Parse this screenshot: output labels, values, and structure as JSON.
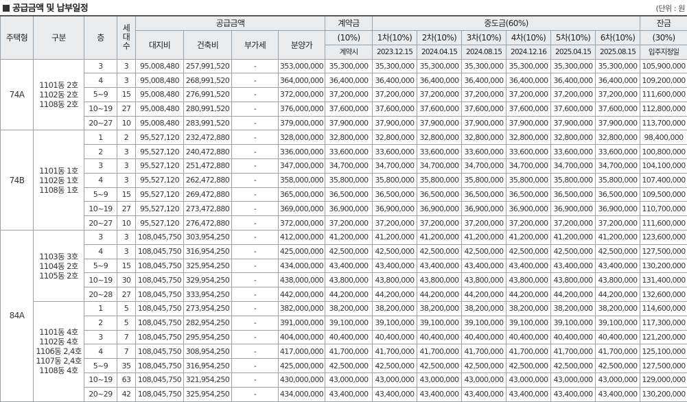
{
  "title": "공급금액 및 납부일정",
  "unit": "(단위 : 원",
  "headers": {
    "type": "주택형",
    "group": "구분",
    "floor": "층",
    "households": "세대수",
    "supply": "공급금액",
    "land": "대지비",
    "building": "건축비",
    "vat": "부가세",
    "sale": "분양가",
    "contract_top": "계약금",
    "contract_pct": "(10%)",
    "contract_when": "계약시",
    "middle": "중도금(60%)",
    "middle_rounds": [
      {
        "label": "1차(10%)",
        "date": "2023.12.15"
      },
      {
        "label": "2차(10%)",
        "date": "2024.04.15"
      },
      {
        "label": "3차(10%)",
        "date": "2024.08.15"
      },
      {
        "label": "4차(10%)",
        "date": "2024.12.16"
      },
      {
        "label": "5차(10%)",
        "date": "2025.04.15"
      },
      {
        "label": "6차(10%)",
        "date": "2025.08.15"
      }
    ],
    "balance_top": "잔금",
    "balance_pct": "(30%)",
    "balance_when": "입주지정일"
  },
  "types": [
    {
      "name": "74A",
      "groups": [
        {
          "dongs": "1101동 2호\n1102동 2호\n1108동 2호",
          "rows": [
            {
              "floor": "3",
              "units": "3",
              "land": "95,008,480",
              "building": "257,991,520",
              "vat": "-",
              "sale": "353,000,000",
              "contract": "35,300,000",
              "mid": "35,300,000",
              "balance": "105,900,000"
            },
            {
              "floor": "4",
              "units": "3",
              "land": "95,008,480",
              "building": "268,991,520",
              "vat": "-",
              "sale": "364,000,000",
              "contract": "36,400,000",
              "mid": "36,400,000",
              "balance": "109,200,000"
            },
            {
              "floor": "5~9",
              "units": "15",
              "land": "95,008,480",
              "building": "276,991,520",
              "vat": "-",
              "sale": "372,000,000",
              "contract": "37,200,000",
              "mid": "37,200,000",
              "balance": "111,600,000"
            },
            {
              "floor": "10~19",
              "units": "27",
              "land": "95,008,480",
              "building": "280,991,520",
              "vat": "-",
              "sale": "376,000,000",
              "contract": "37,600,000",
              "mid": "37,600,000",
              "balance": "112,800,000"
            },
            {
              "floor": "20~27",
              "units": "10",
              "land": "95,008,480",
              "building": "283,991,520",
              "vat": "-",
              "sale": "379,000,000",
              "contract": "37,900,000",
              "mid": "37,900,000",
              "balance": "113,700,000"
            }
          ]
        }
      ]
    },
    {
      "name": "74B",
      "groups": [
        {
          "dongs": "1101동 1호\n1102동 1호\n1108동 1호",
          "rows": [
            {
              "floor": "1",
              "units": "2",
              "land": "95,527,120",
              "building": "232,472,880",
              "vat": "-",
              "sale": "328,000,000",
              "contract": "32,800,000",
              "mid": "32,800,000",
              "balance": "98,400,000"
            },
            {
              "floor": "2",
              "units": "3",
              "land": "95,527,120",
              "building": "240,472,880",
              "vat": "-",
              "sale": "336,000,000",
              "contract": "33,600,000",
              "mid": "33,600,000",
              "balance": "100,800,000"
            },
            {
              "floor": "3",
              "units": "3",
              "land": "95,527,120",
              "building": "251,472,880",
              "vat": "-",
              "sale": "347,000,000",
              "contract": "34,700,000",
              "mid": "34,700,000",
              "balance": "104,100,000"
            },
            {
              "floor": "4",
              "units": "3",
              "land": "95,527,120",
              "building": "262,472,880",
              "vat": "-",
              "sale": "358,000,000",
              "contract": "35,800,000",
              "mid": "35,800,000",
              "balance": "107,400,000"
            },
            {
              "floor": "5~9",
              "units": "15",
              "land": "95,527,120",
              "building": "269,472,880",
              "vat": "-",
              "sale": "365,000,000",
              "contract": "36,500,000",
              "mid": "36,500,000",
              "balance": "109,500,000"
            },
            {
              "floor": "10~19",
              "units": "27",
              "land": "95,527,120",
              "building": "273,472,880",
              "vat": "-",
              "sale": "369,000,000",
              "contract": "36,900,000",
              "mid": "36,900,000",
              "balance": "110,700,000"
            },
            {
              "floor": "20~27",
              "units": "10",
              "land": "95,527,120",
              "building": "276,472,880",
              "vat": "-",
              "sale": "372,000,000",
              "contract": "37,200,000",
              "mid": "37,200,000",
              "balance": "111,600,000"
            }
          ]
        }
      ]
    },
    {
      "name": "84A",
      "groups": [
        {
          "dongs": "1103동 3호\n1104동 2호\n1105동 2호",
          "rows": [
            {
              "floor": "3",
              "units": "3",
              "land": "108,045,750",
              "building": "303,954,250",
              "vat": "-",
              "sale": "412,000,000",
              "contract": "41,200,000",
              "mid": "41,200,000",
              "balance": "123,600,000"
            },
            {
              "floor": "4",
              "units": "3",
              "land": "108,045,750",
              "building": "316,954,250",
              "vat": "-",
              "sale": "425,000,000",
              "contract": "42,500,000",
              "mid": "42,500,000",
              "balance": "127,500,000"
            },
            {
              "floor": "5~9",
              "units": "15",
              "land": "108,045,750",
              "building": "325,954,250",
              "vat": "-",
              "sale": "434,000,000",
              "contract": "43,400,000",
              "mid": "43,400,000",
              "balance": "130,200,000"
            },
            {
              "floor": "10~19",
              "units": "30",
              "land": "108,045,750",
              "building": "329,954,250",
              "vat": "-",
              "sale": "438,000,000",
              "contract": "43,800,000",
              "mid": "43,800,000",
              "balance": "131,400,000"
            },
            {
              "floor": "20~28",
              "units": "27",
              "land": "108,045,750",
              "building": "333,954,250",
              "vat": "-",
              "sale": "442,000,000",
              "contract": "44,200,000",
              "mid": "44,200,000",
              "balance": "132,600,000"
            }
          ]
        },
        {
          "dongs": "1101동 4호\n1102동 4호\n1106동 2,4호\n1107동 2,4호\n1108동 4호",
          "rows": [
            {
              "floor": "1",
              "units": "5",
              "land": "108,045,750",
              "building": "273,954,250",
              "vat": "-",
              "sale": "382,000,000",
              "contract": "38,200,000",
              "mid": "38,200,000",
              "balance": "114,600,000"
            },
            {
              "floor": "2",
              "units": "5",
              "land": "108,045,750",
              "building": "282,954,250",
              "vat": "-",
              "sale": "391,000,000",
              "contract": "39,100,000",
              "mid": "39,100,000",
              "balance": "117,300,000"
            },
            {
              "floor": "3",
              "units": "7",
              "land": "108,045,750",
              "building": "295,954,250",
              "vat": "-",
              "sale": "404,000,000",
              "contract": "40,400,000",
              "mid": "40,400,000",
              "balance": "121,200,000"
            },
            {
              "floor": "4",
              "units": "7",
              "land": "108,045,750",
              "building": "308,954,250",
              "vat": "-",
              "sale": "417,000,000",
              "contract": "41,700,000",
              "mid": "41,700,000",
              "balance": "125,100,000"
            },
            {
              "floor": "5~9",
              "units": "35",
              "land": "108,045,750",
              "building": "316,954,250",
              "vat": "-",
              "sale": "425,000,000",
              "contract": "42,500,000",
              "mid": "42,500,000",
              "balance": "127,500,000"
            },
            {
              "floor": "10~19",
              "units": "63",
              "land": "108,045,750",
              "building": "321,954,250",
              "vat": "-",
              "sale": "430,000,000",
              "contract": "43,000,000",
              "mid": "43,000,000",
              "balance": "129,000,000"
            },
            {
              "floor": "20~29",
              "units": "42",
              "land": "108,045,750",
              "building": "325,954,250",
              "vat": "-",
              "sale": "434,000,000",
              "contract": "43,400,000",
              "mid": "43,400,000",
              "balance": "130,200,000"
            }
          ]
        }
      ]
    }
  ]
}
